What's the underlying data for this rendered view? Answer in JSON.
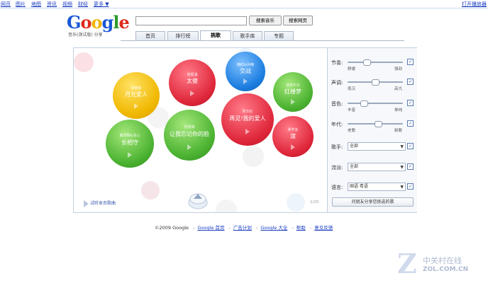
{
  "topnav": {
    "items": [
      "网页",
      "图片",
      "地图",
      "资讯",
      "视频",
      "财经",
      "更多 ▼"
    ],
    "right_link": "打开播放器"
  },
  "logo": {
    "word": "Google",
    "subtitle": "音乐(测试版) 分享"
  },
  "search": {
    "query": "",
    "music_button": "搜索音乐",
    "web_button": "搜索网页"
  },
  "tabs": [
    "首页",
    "排行榜",
    "挑歌",
    "歌手库",
    "专题"
  ],
  "active_tab": 2,
  "bubbles": [
    {
      "artist": "梁静茹",
      "title": "月光爱人",
      "color": "yellow"
    },
    {
      "artist": "张韶涵",
      "title": "太傻",
      "color": "red"
    },
    {
      "artist": "韩红&孙楠",
      "title": "交战",
      "color": "blue"
    },
    {
      "artist": "迪克牛仔",
      "title": "红楼梦",
      "color": "green"
    },
    {
      "artist": "屠洪刚&关心",
      "title": "长相守",
      "color": "green"
    },
    {
      "artist": "张惠妹",
      "title": "让我忘记你的脸",
      "color": "green"
    },
    {
      "artist": "周杰伦",
      "title": "再见!我的爱人",
      "color": "red"
    },
    {
      "artist": "张学友",
      "title": "渡",
      "color": "red"
    }
  ],
  "listen_label": "试听本页歌曲",
  "page_info": "1/20",
  "controls": [
    {
      "label": "节奏:",
      "min": "舒缓",
      "max": "强劲",
      "value": 0.35
    },
    {
      "label": "声调:",
      "min": "低沉",
      "max": "高亢",
      "value": 0.5
    },
    {
      "label": "音色:",
      "min": "丰富",
      "max": "单纯",
      "value": 0.3
    },
    {
      "label": "年代:",
      "min": "老歌",
      "max": "新歌",
      "value": 0.55
    }
  ],
  "selects": [
    {
      "label": "歌手:",
      "value": "全部"
    },
    {
      "label": "流派:",
      "value": "全部"
    },
    {
      "label": "语言:",
      "value": "国语 粤语"
    }
  ],
  "share_button": "问朋友分享您挑选的歌",
  "footer": {
    "copyright": "©2009 Google",
    "links": [
      "Google 首页",
      "广告计划",
      "Google 大全",
      "帮助",
      "意见反馈"
    ]
  },
  "watermark": {
    "cn": "中关村在线",
    "en": "ZOL.COM.CN"
  },
  "colors": {
    "yellow": "#f0b800",
    "red": "#e0283c",
    "blue": "#1d7ee0",
    "green": "#4cb332",
    "link": "#1a3dc1"
  }
}
